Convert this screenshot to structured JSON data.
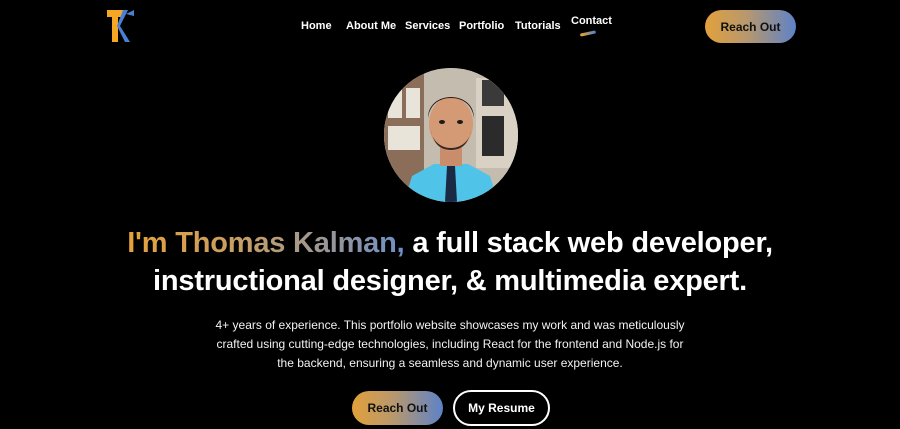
{
  "brand": {
    "logo_text": "TK",
    "colors": {
      "orange": "#F5A623",
      "blue": "#4A7FD4"
    }
  },
  "nav": {
    "items": [
      {
        "label": "Home"
      },
      {
        "label": "About Me"
      },
      {
        "label": "Services"
      },
      {
        "label": "Portfolio"
      },
      {
        "label": "Tutorials"
      },
      {
        "label": "Contact"
      }
    ],
    "active": "Contact"
  },
  "header": {
    "cta_label": "Reach Out"
  },
  "hero": {
    "avatar_alt": "Portrait photo",
    "headline_name": "I'm Thomas Kalman,",
    "headline_rest_line1": " a full stack web developer,",
    "headline_line2": "instructional designer, & multimedia expert.",
    "description_lines": [
      "4+ years of experience. This portfolio website showcases my work and was meticulously",
      "crafted using cutting-edge technologies, including React for the frontend and Node.js for",
      "the backend, ensuring a seamless and dynamic user experience."
    ],
    "primary_button": "Reach Out",
    "secondary_button": "My Resume"
  }
}
